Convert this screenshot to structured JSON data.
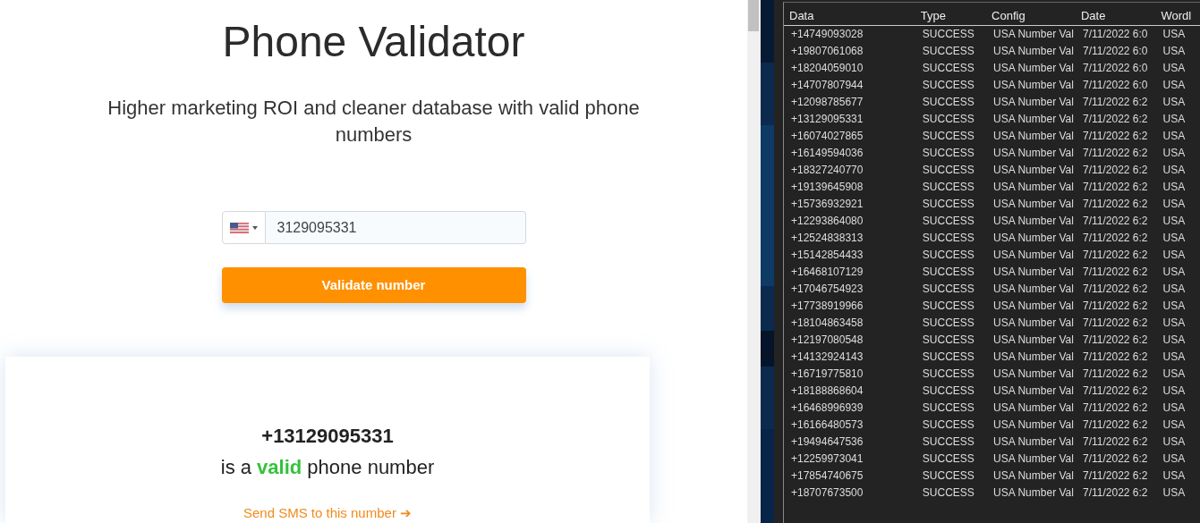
{
  "page": {
    "title": "Phone Validator",
    "subtitle": "Higher marketing ROI and cleaner database with valid phone numbers"
  },
  "phone_input": {
    "value": "3129095331"
  },
  "validate_button": "Validate number",
  "result": {
    "number": "+13129095331",
    "before": "is a ",
    "status": "valid",
    "after": " phone number",
    "link": "Send SMS to this number ➔"
  },
  "table": {
    "columns": [
      "Data",
      "Type",
      "Config",
      "Date",
      "Wordl"
    ],
    "rows": [
      [
        "+14749093028",
        "SUCCESS",
        "USA Number Val",
        "7/11/2022 6:0",
        "USA"
      ],
      [
        "+19807061068",
        "SUCCESS",
        "USA Number Val",
        "7/11/2022 6:0",
        "USA"
      ],
      [
        "+18204059010",
        "SUCCESS",
        "USA Number Val",
        "7/11/2022 6:0",
        "USA"
      ],
      [
        "+14707807944",
        "SUCCESS",
        "USA Number Val",
        "7/11/2022 6:0",
        "USA"
      ],
      [
        "+12098785677",
        "SUCCESS",
        "USA Number Val",
        "7/11/2022 6:2",
        "USA"
      ],
      [
        "+13129095331",
        "SUCCESS",
        "USA Number Val",
        "7/11/2022 6:2",
        "USA"
      ],
      [
        "+16074027865",
        "SUCCESS",
        "USA Number Val",
        "7/11/2022 6:2",
        "USA"
      ],
      [
        "+16149594036",
        "SUCCESS",
        "USA Number Val",
        "7/11/2022 6:2",
        "USA"
      ],
      [
        "+18327240770",
        "SUCCESS",
        "USA Number Val",
        "7/11/2022 6:2",
        "USA"
      ],
      [
        "+19139645908",
        "SUCCESS",
        "USA Number Val",
        "7/11/2022 6:2",
        "USA"
      ],
      [
        "+15736932921",
        "SUCCESS",
        "USA Number Val",
        "7/11/2022 6:2",
        "USA"
      ],
      [
        "+12293864080",
        "SUCCESS",
        "USA Number Val",
        "7/11/2022 6:2",
        "USA"
      ],
      [
        "+12524838313",
        "SUCCESS",
        "USA Number Val",
        "7/11/2022 6:2",
        "USA"
      ],
      [
        "+15142854433",
        "SUCCESS",
        "USA Number Val",
        "7/11/2022 6:2",
        "USA"
      ],
      [
        "+16468107129",
        "SUCCESS",
        "USA Number Val",
        "7/11/2022 6:2",
        "USA"
      ],
      [
        "+17046754923",
        "SUCCESS",
        "USA Number Val",
        "7/11/2022 6:2",
        "USA"
      ],
      [
        "+17738919966",
        "SUCCESS",
        "USA Number Val",
        "7/11/2022 6:2",
        "USA"
      ],
      [
        "+18104863458",
        "SUCCESS",
        "USA Number Val",
        "7/11/2022 6:2",
        "USA"
      ],
      [
        "+12197080548",
        "SUCCESS",
        "USA Number Val",
        "7/11/2022 6:2",
        "USA"
      ],
      [
        "+14132924143",
        "SUCCESS",
        "USA Number Val",
        "7/11/2022 6:2",
        "USA"
      ],
      [
        "+16719775810",
        "SUCCESS",
        "USA Number Val",
        "7/11/2022 6:2",
        "USA"
      ],
      [
        "+18188868604",
        "SUCCESS",
        "USA Number Val",
        "7/11/2022 6:2",
        "USA"
      ],
      [
        "+16468996939",
        "SUCCESS",
        "USA Number Val",
        "7/11/2022 6:2",
        "USA"
      ],
      [
        "+16166480573",
        "SUCCESS",
        "USA Number Val",
        "7/11/2022 6:2",
        "USA"
      ],
      [
        "+19494647536",
        "SUCCESS",
        "USA Number Val",
        "7/11/2022 6:2",
        "USA"
      ],
      [
        "+12259973041",
        "SUCCESS",
        "USA Number Val",
        "7/11/2022 6:2",
        "USA"
      ],
      [
        "+17854740675",
        "SUCCESS",
        "USA Number Val",
        "7/11/2022 6:2",
        "USA"
      ],
      [
        "+18707673500",
        "SUCCESS",
        "USA Number Val",
        "7/11/2022 6:2",
        "USA"
      ]
    ]
  }
}
